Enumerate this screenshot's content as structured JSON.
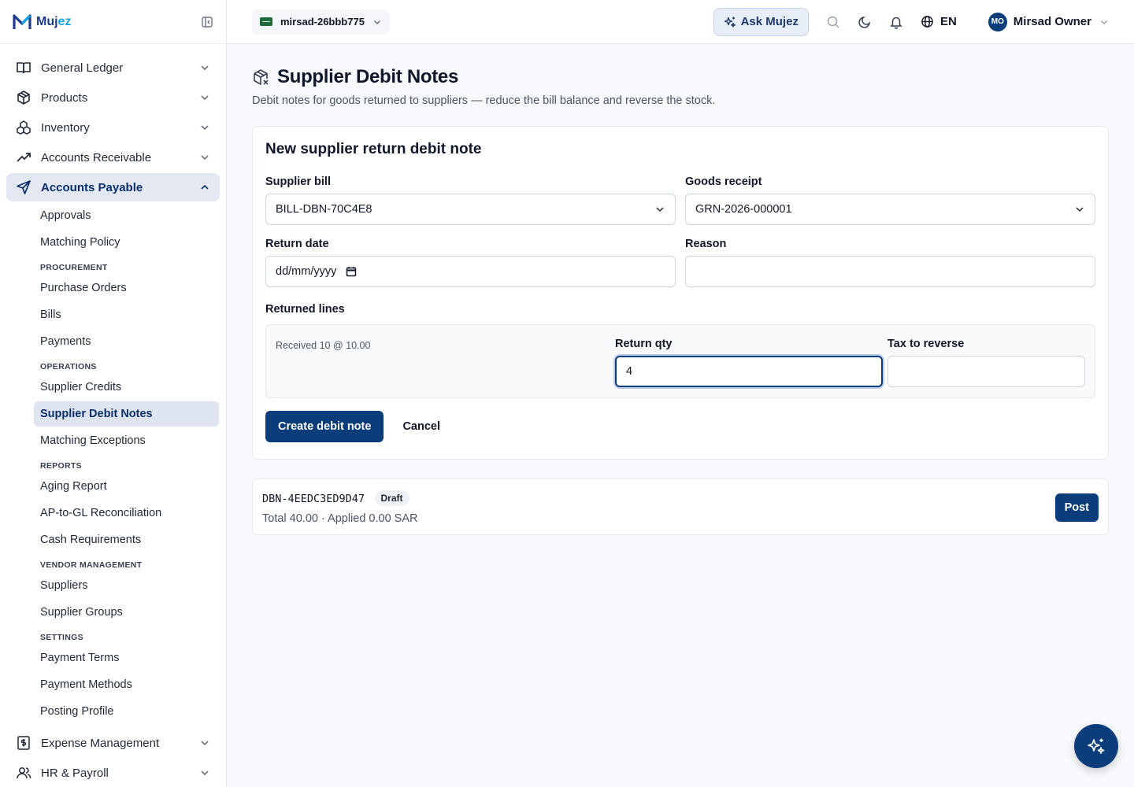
{
  "brand": {
    "name_main": "Muj",
    "name_accent": "ez"
  },
  "topbar": {
    "tenant": "mirsad-26bbb775",
    "ask_label": "Ask Mujez",
    "language": "EN",
    "user_initials": "MO",
    "user_name": "Mirsad Owner"
  },
  "sidebar": {
    "sections": [
      {
        "label": "General Ledger",
        "icon": "book-icon"
      },
      {
        "label": "Products",
        "icon": "box-icon"
      },
      {
        "label": "Inventory",
        "icon": "boxes-icon"
      },
      {
        "label": "Accounts Receivable",
        "icon": "trend-up-icon"
      }
    ],
    "active_section": "Accounts Payable",
    "ap_items": {
      "approvals": "Approvals",
      "matching_policy": "Matching Policy",
      "procurement_head": "PROCUREMENT",
      "purchase_orders": "Purchase Orders",
      "bills": "Bills",
      "payments": "Payments",
      "operations_head": "OPERATIONS",
      "supplier_credits": "Supplier Credits",
      "supplier_debit_notes": "Supplier Debit Notes",
      "matching_exceptions": "Matching Exceptions",
      "reports_head": "REPORTS",
      "aging_report": "Aging Report",
      "ap_gl_recon": "AP-to-GL Reconciliation",
      "cash_requirements": "Cash Requirements",
      "vendor_head": "VENDOR MANAGEMENT",
      "suppliers": "Suppliers",
      "supplier_groups": "Supplier Groups",
      "settings_head": "SETTINGS",
      "payment_terms": "Payment Terms",
      "payment_methods": "Payment Methods",
      "posting_profile": "Posting Profile"
    },
    "bottom_sections": [
      {
        "label": "Expense Management",
        "icon": "receipt-icon"
      },
      {
        "label": "HR & Payroll",
        "icon": "users-icon"
      }
    ]
  },
  "page": {
    "title": "Supplier Debit Notes",
    "subtitle": "Debit notes for goods returned to suppliers — reduce the bill balance and reverse the stock."
  },
  "form": {
    "title": "New supplier return debit note",
    "supplier_bill_label": "Supplier bill",
    "supplier_bill_value": "BILL-DBN-70C4E8",
    "goods_receipt_label": "Goods receipt",
    "goods_receipt_value": "GRN-2026-000001",
    "return_date_label": "Return date",
    "return_date_placeholder": "dd/mm/yyyy",
    "reason_label": "Reason",
    "reason_value": "",
    "returned_lines_label": "Returned lines",
    "line_received": "Received 10 @ 10.00",
    "return_qty_label": "Return qty",
    "return_qty_value": "4",
    "tax_label": "Tax to reverse",
    "tax_value": "",
    "create_label": "Create debit note",
    "cancel_label": "Cancel"
  },
  "note": {
    "code": "DBN-4EEDC3ED9D47",
    "status": "Draft",
    "meta": "Total 40.00 · Applied 0.00 SAR",
    "post_label": "Post"
  }
}
